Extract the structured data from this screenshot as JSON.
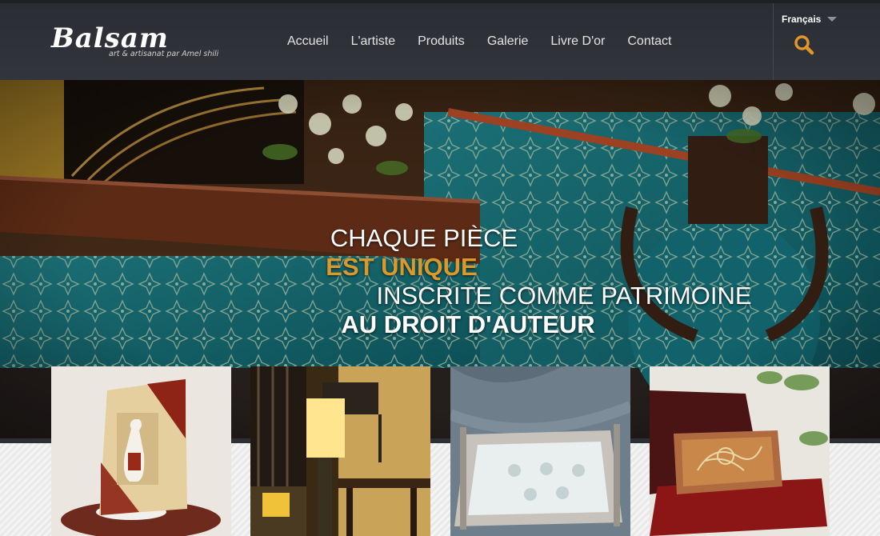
{
  "brand": {
    "name": "Balsam",
    "tagline": "art & artisanat  par Amel shili"
  },
  "nav": {
    "items": [
      "Accueil",
      "L'artiste",
      "Produits",
      "Galerie",
      "Livre D'or",
      "Contact"
    ]
  },
  "language": {
    "selected": "Français"
  },
  "icons": {
    "search": "search-icon",
    "language_dropdown": "chevron-down-icon"
  },
  "hero": {
    "lines": [
      "CHAQUE PIÈCE",
      "EST UNIQUE",
      "INSCRITE COMME PATRIMOINE",
      "AU DROIT D'AUTEUR"
    ]
  },
  "colors": {
    "accent": "#e0962a",
    "header_bg": "#2e3136",
    "slogan_highlight": "#d99a2b"
  }
}
